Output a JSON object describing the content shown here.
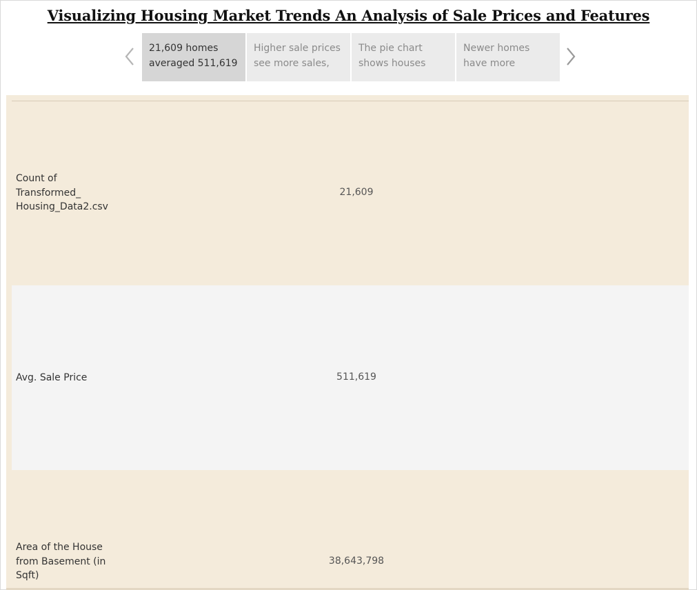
{
  "title": "Visualizing Housing Market Trends An Analysis of Sale Prices and Features",
  "story_points": [
    {
      "line1": "21,609 homes",
      "line2": "averaged 511,619",
      "active": true
    },
    {
      "line1": "Higher sale prices",
      "line2": "see more sales,",
      "active": false
    },
    {
      "line1": "The pie chart",
      "line2": "shows houses",
      "active": false
    },
    {
      "line1": "Newer homes",
      "line2": "have more",
      "active": false
    }
  ],
  "rows": [
    {
      "label_lines": [
        "Count of",
        "Transformed_",
        "Housing_Data2.csv"
      ],
      "value": "21,609"
    },
    {
      "label_lines": [
        "Avg. Sale Price"
      ],
      "value": "511,619"
    },
    {
      "label_lines": [
        "Area of the House",
        "from Basement (in",
        "Sqft)"
      ],
      "value": "38,643,798"
    }
  ],
  "colors": {
    "content_background": "#f4ebdb",
    "alternate_row": "#f4f4f4",
    "active_story_point": "#d6d6d6",
    "inactive_story_point": "#ebebeb"
  },
  "icons": {
    "previous": "chevron-left-icon",
    "next": "chevron-right-icon"
  }
}
